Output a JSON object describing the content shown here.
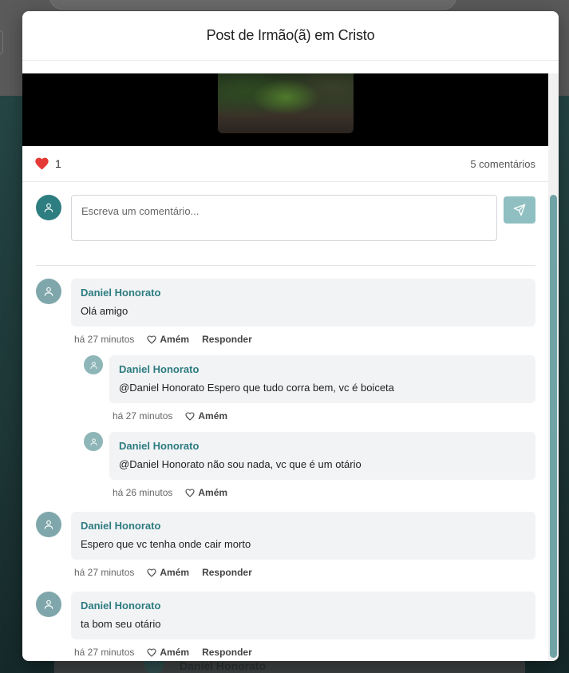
{
  "background": {
    "card_author": "Daniel Honorato"
  },
  "modal": {
    "title": "Post de Irmão(ã) em Cristo"
  },
  "post": {
    "likes": "1",
    "comments_label": "5 comentários"
  },
  "composer": {
    "placeholder": "Escreva um comentário..."
  },
  "comments": [
    {
      "author": "Daniel Honorato",
      "text": "Olá amigo",
      "time": "há 27 minutos",
      "amen": "Amém",
      "reply": "Responder",
      "replies": [
        {
          "author": "Daniel Honorato",
          "text": "@Daniel Honorato Espero que tudo corra bem, vc é boiceta",
          "time": "há 27 minutos",
          "amen": "Amém"
        },
        {
          "author": "Daniel Honorato",
          "text": "@Daniel Honorato não sou nada, vc que é um otário",
          "time": "há 26 minutos",
          "amen": "Amém"
        }
      ]
    },
    {
      "author": "Daniel Honorato",
      "text": "Espero que vc tenha onde cair morto",
      "time": "há 27 minutos",
      "amen": "Amém",
      "reply": "Responder"
    },
    {
      "author": "Daniel Honorato",
      "text": "ta bom seu otário",
      "time": "há 27 minutos",
      "amen": "Amém",
      "reply": "Responder"
    }
  ],
  "colors": {
    "accent": "#2c7c80",
    "like": "#e53935",
    "send_button": "#8fbfc1"
  }
}
